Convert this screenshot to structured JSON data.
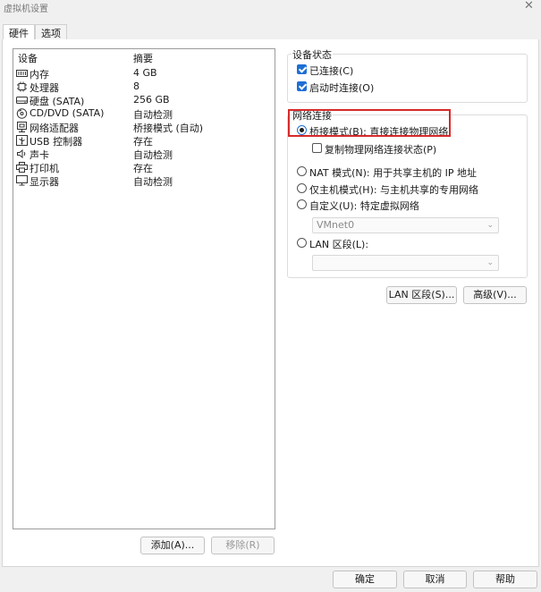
{
  "window": {
    "title": "虚拟机设置",
    "close_glyph": "✕"
  },
  "tabs": [
    {
      "label": "硬件",
      "active": true
    },
    {
      "label": "选项",
      "active": false
    }
  ],
  "device_list": {
    "columns": [
      "设备",
      "摘要"
    ],
    "rows": [
      {
        "name": "内存",
        "summary": "4 GB",
        "icon": "memory-icon"
      },
      {
        "name": "处理器",
        "summary": "8",
        "icon": "cpu-icon"
      },
      {
        "name": "硬盘 (SATA)",
        "summary": "256 GB",
        "icon": "hard-disk-icon"
      },
      {
        "name": "CD/DVD (SATA)",
        "summary": "自动检测",
        "icon": "cd-dvd-icon"
      },
      {
        "name": "网络适配器",
        "summary": "桥接模式 (自动)",
        "icon": "network-adapter-icon"
      },
      {
        "name": "USB 控制器",
        "summary": "存在",
        "icon": "usb-icon"
      },
      {
        "name": "声卡",
        "summary": "自动检测",
        "icon": "speaker-icon"
      },
      {
        "name": "打印机",
        "summary": "存在",
        "icon": "printer-icon"
      },
      {
        "name": "显示器",
        "summary": "自动检测",
        "icon": "monitor-icon"
      }
    ]
  },
  "device_buttons": {
    "add": "添加(A)...",
    "remove": "移除(R)"
  },
  "device_status": {
    "title": "设备状态",
    "connected": {
      "label": "已连接(C)",
      "checked": true
    },
    "connect_at_power_on": {
      "label": "启动时连接(O)",
      "checked": true
    }
  },
  "network": {
    "title": "网络连接",
    "bridged": {
      "label": "桥接模式(B): 直接连接物理网络",
      "selected": true
    },
    "replicate": {
      "label": "复制物理网络连接状态(P)",
      "checked": false
    },
    "nat": {
      "label": "NAT 模式(N): 用于共享主机的 IP 地址",
      "selected": false
    },
    "host_only": {
      "label": "仅主机模式(H): 与主机共享的专用网络",
      "selected": false
    },
    "custom": {
      "label": "自定义(U): 特定虚拟网络",
      "selected": false,
      "value": "VMnet0"
    },
    "lan_segment": {
      "label": "LAN 区段(L):",
      "selected": false,
      "value": ""
    },
    "lan_segments_button": "LAN 区段(S)...",
    "advanced_button": "高级(V)..."
  },
  "footer": {
    "ok": "确定",
    "cancel": "取消",
    "help": "帮助"
  },
  "colors": {
    "accent": "#1f6fd4",
    "highlight_box": "#d62a2a"
  }
}
